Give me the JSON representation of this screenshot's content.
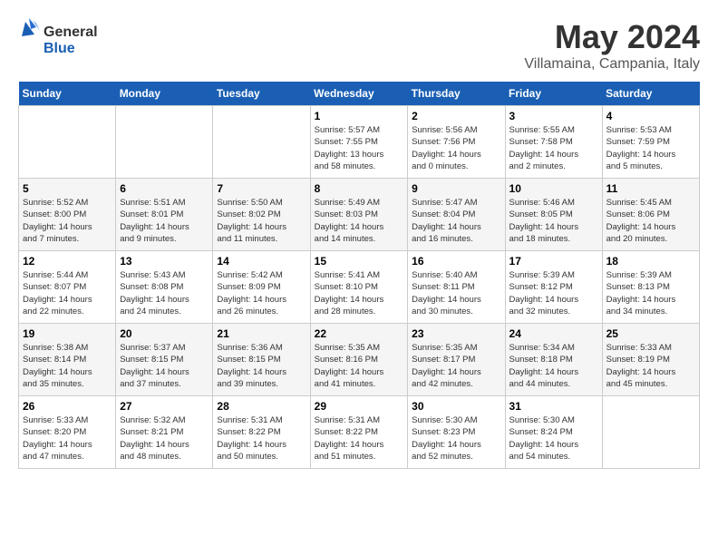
{
  "header": {
    "logo_general": "General",
    "logo_blue": "Blue",
    "month_year": "May 2024",
    "location": "Villamaina, Campania, Italy"
  },
  "weekdays": [
    "Sunday",
    "Monday",
    "Tuesday",
    "Wednesday",
    "Thursday",
    "Friday",
    "Saturday"
  ],
  "weeks": [
    [
      {
        "day": "",
        "info": ""
      },
      {
        "day": "",
        "info": ""
      },
      {
        "day": "",
        "info": ""
      },
      {
        "day": "1",
        "info": "Sunrise: 5:57 AM\nSunset: 7:55 PM\nDaylight: 13 hours\nand 58 minutes."
      },
      {
        "day": "2",
        "info": "Sunrise: 5:56 AM\nSunset: 7:56 PM\nDaylight: 14 hours\nand 0 minutes."
      },
      {
        "day": "3",
        "info": "Sunrise: 5:55 AM\nSunset: 7:58 PM\nDaylight: 14 hours\nand 2 minutes."
      },
      {
        "day": "4",
        "info": "Sunrise: 5:53 AM\nSunset: 7:59 PM\nDaylight: 14 hours\nand 5 minutes."
      }
    ],
    [
      {
        "day": "5",
        "info": "Sunrise: 5:52 AM\nSunset: 8:00 PM\nDaylight: 14 hours\nand 7 minutes."
      },
      {
        "day": "6",
        "info": "Sunrise: 5:51 AM\nSunset: 8:01 PM\nDaylight: 14 hours\nand 9 minutes."
      },
      {
        "day": "7",
        "info": "Sunrise: 5:50 AM\nSunset: 8:02 PM\nDaylight: 14 hours\nand 11 minutes."
      },
      {
        "day": "8",
        "info": "Sunrise: 5:49 AM\nSunset: 8:03 PM\nDaylight: 14 hours\nand 14 minutes."
      },
      {
        "day": "9",
        "info": "Sunrise: 5:47 AM\nSunset: 8:04 PM\nDaylight: 14 hours\nand 16 minutes."
      },
      {
        "day": "10",
        "info": "Sunrise: 5:46 AM\nSunset: 8:05 PM\nDaylight: 14 hours\nand 18 minutes."
      },
      {
        "day": "11",
        "info": "Sunrise: 5:45 AM\nSunset: 8:06 PM\nDaylight: 14 hours\nand 20 minutes."
      }
    ],
    [
      {
        "day": "12",
        "info": "Sunrise: 5:44 AM\nSunset: 8:07 PM\nDaylight: 14 hours\nand 22 minutes."
      },
      {
        "day": "13",
        "info": "Sunrise: 5:43 AM\nSunset: 8:08 PM\nDaylight: 14 hours\nand 24 minutes."
      },
      {
        "day": "14",
        "info": "Sunrise: 5:42 AM\nSunset: 8:09 PM\nDaylight: 14 hours\nand 26 minutes."
      },
      {
        "day": "15",
        "info": "Sunrise: 5:41 AM\nSunset: 8:10 PM\nDaylight: 14 hours\nand 28 minutes."
      },
      {
        "day": "16",
        "info": "Sunrise: 5:40 AM\nSunset: 8:11 PM\nDaylight: 14 hours\nand 30 minutes."
      },
      {
        "day": "17",
        "info": "Sunrise: 5:39 AM\nSunset: 8:12 PM\nDaylight: 14 hours\nand 32 minutes."
      },
      {
        "day": "18",
        "info": "Sunrise: 5:39 AM\nSunset: 8:13 PM\nDaylight: 14 hours\nand 34 minutes."
      }
    ],
    [
      {
        "day": "19",
        "info": "Sunrise: 5:38 AM\nSunset: 8:14 PM\nDaylight: 14 hours\nand 35 minutes."
      },
      {
        "day": "20",
        "info": "Sunrise: 5:37 AM\nSunset: 8:15 PM\nDaylight: 14 hours\nand 37 minutes."
      },
      {
        "day": "21",
        "info": "Sunrise: 5:36 AM\nSunset: 8:15 PM\nDaylight: 14 hours\nand 39 minutes."
      },
      {
        "day": "22",
        "info": "Sunrise: 5:35 AM\nSunset: 8:16 PM\nDaylight: 14 hours\nand 41 minutes."
      },
      {
        "day": "23",
        "info": "Sunrise: 5:35 AM\nSunset: 8:17 PM\nDaylight: 14 hours\nand 42 minutes."
      },
      {
        "day": "24",
        "info": "Sunrise: 5:34 AM\nSunset: 8:18 PM\nDaylight: 14 hours\nand 44 minutes."
      },
      {
        "day": "25",
        "info": "Sunrise: 5:33 AM\nSunset: 8:19 PM\nDaylight: 14 hours\nand 45 minutes."
      }
    ],
    [
      {
        "day": "26",
        "info": "Sunrise: 5:33 AM\nSunset: 8:20 PM\nDaylight: 14 hours\nand 47 minutes."
      },
      {
        "day": "27",
        "info": "Sunrise: 5:32 AM\nSunset: 8:21 PM\nDaylight: 14 hours\nand 48 minutes."
      },
      {
        "day": "28",
        "info": "Sunrise: 5:31 AM\nSunset: 8:22 PM\nDaylight: 14 hours\nand 50 minutes."
      },
      {
        "day": "29",
        "info": "Sunrise: 5:31 AM\nSunset: 8:22 PM\nDaylight: 14 hours\nand 51 minutes."
      },
      {
        "day": "30",
        "info": "Sunrise: 5:30 AM\nSunset: 8:23 PM\nDaylight: 14 hours\nand 52 minutes."
      },
      {
        "day": "31",
        "info": "Sunrise: 5:30 AM\nSunset: 8:24 PM\nDaylight: 14 hours\nand 54 minutes."
      },
      {
        "day": "",
        "info": ""
      }
    ]
  ]
}
